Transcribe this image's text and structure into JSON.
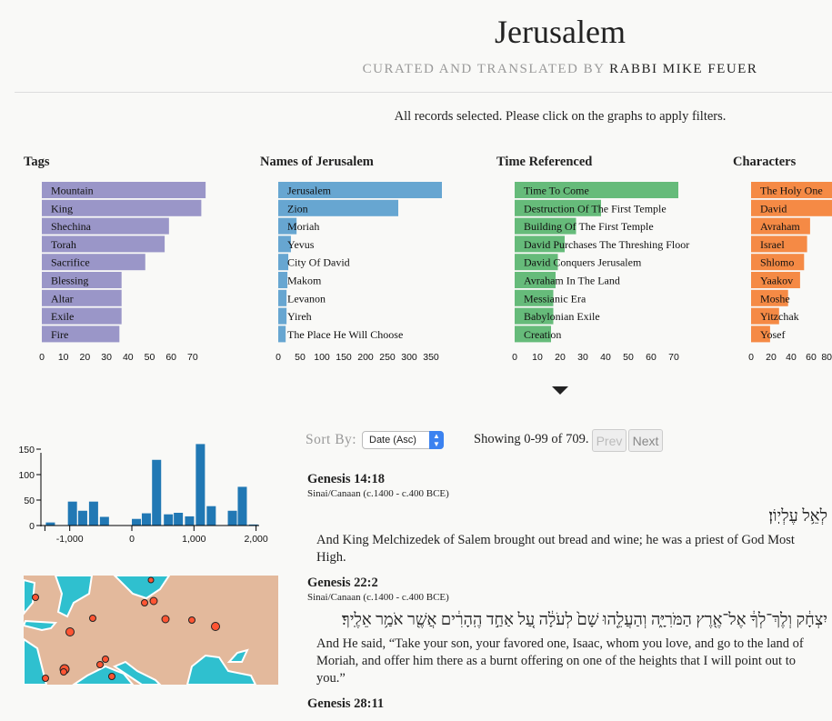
{
  "header": {
    "title": "Jerusalem",
    "subtitle_prefix": "CURATED AND TRANSLATED BY",
    "subtitle_author": "RABBI MIKE FEUER",
    "status": "All records selected. Please click on the graphs to apply filters."
  },
  "chart_data": [
    {
      "type": "bar",
      "orientation": "horizontal",
      "title": "Tags",
      "color": "#9a96c8",
      "categories": [
        "Mountain",
        "King",
        "Shechina",
        "Torah",
        "Sacrifice",
        "Blessing",
        "Altar",
        "Exile",
        "Fire"
      ],
      "values": [
        76,
        74,
        59,
        57,
        48,
        37,
        37,
        37,
        36
      ],
      "ticks": [
        0,
        10,
        20,
        30,
        40,
        50,
        60,
        70
      ],
      "xlim": [
        0,
        76
      ]
    },
    {
      "type": "bar",
      "orientation": "horizontal",
      "title": "Names of Jerusalem",
      "color": "#67a6d1",
      "categories": [
        "Jerusalem",
        "Zion",
        "Moriah",
        "Yevus",
        "City Of David",
        "Makom",
        "Levanon",
        "Yireh",
        "The Place He Will Choose"
      ],
      "values": [
        375,
        275,
        42,
        29,
        23,
        21,
        19,
        19,
        17
      ],
      "ticks": [
        0,
        50,
        100,
        150,
        200,
        250,
        300,
        350
      ],
      "xlim": [
        0,
        375
      ]
    },
    {
      "type": "bar",
      "orientation": "horizontal",
      "title": "Time Referenced",
      "color": "#66bb7a",
      "categories": [
        "Time To Come",
        "Destruction Of The First Temple",
        "Building Of The First Temple",
        "David Purchases The Threshing Floor",
        "David Conquers Jerusalem",
        "Avraham In The Land",
        "Messianic Era",
        "Babylonian Exile",
        "Creation"
      ],
      "values": [
        72,
        38,
        27,
        22,
        19,
        18,
        17,
        17,
        16
      ],
      "ticks": [
        0,
        10,
        20,
        30,
        40,
        50,
        60,
        70
      ],
      "xlim": [
        0,
        72
      ]
    },
    {
      "type": "bar",
      "orientation": "horizontal",
      "title": "Characters",
      "color": "#f58a45",
      "categories": [
        "The Holy One",
        "David",
        "Avraham",
        "Israel",
        "Shlomo",
        "Yaakov",
        "Moshe",
        "Yitzchak",
        "Yosef"
      ],
      "values": [
        100,
        95,
        59,
        56,
        53,
        49,
        37,
        28,
        19
      ],
      "ticks": [
        0,
        20,
        40,
        60,
        80
      ],
      "xlim": [
        0,
        100
      ]
    },
    {
      "type": "histogram",
      "color": "#2178b4",
      "x": [
        -1370,
        -1015,
        -850,
        -675,
        -500,
        15,
        175,
        340,
        530,
        690,
        870,
        1045,
        1220,
        1560,
        1720,
        1900
      ],
      "values": [
        6,
        47,
        29,
        47,
        17,
        13,
        24,
        129,
        22,
        25,
        18,
        160,
        38,
        29,
        76,
        2
      ],
      "xticks": [
        -1000,
        0,
        1000,
        2000
      ],
      "xtick_labels": [
        "-1,000",
        "0",
        "1,000",
        "2,000"
      ],
      "yticks": [
        0,
        50,
        100,
        150
      ],
      "xlim": [
        -1400,
        2000
      ],
      "ylim": [
        0,
        160
      ]
    }
  ],
  "map": {
    "land_color": "#e3b99c",
    "water_color": "#2fc0cf",
    "marker_color": "#ff5533"
  },
  "controls": {
    "sort_label": "Sort By:",
    "sort_value": "Date (Asc)",
    "showing": "Showing 0-99 of 709.",
    "prev": "Prev",
    "next": "Next"
  },
  "records": [
    {
      "ref": "Genesis 14:18",
      "era": "Sinai/Canaan (c.1400 - c.400 BCE)",
      "hebrew": "לְאֵ֥ל עֶלְיֽוֹן׃",
      "english": "And King Melchizedek of Salem brought out bread and wine; he was a priest of God Most High."
    },
    {
      "ref": "Genesis 22:2",
      "era": "Sinai/Canaan (c.1400 - c.400 BCE)",
      "hebrew": "יִצְחָ֔ק וְלֶךְ־לְךָ֔ אֶל־אֶ֖רֶץ הַמֹּרִיָּ֑ה וְהַעֲלֵ֤הוּ שָׁם֙ לְעֹלָ֔ה עַ֚ל אַחַ֣ד הֶֽהָרִ֔ים אֲשֶׁ֖ר אֹמַ֥ר אֵלֶֽיךָ׃",
      "english": "And He said, “Take your son, your favored one, Isaac, whom you love, and go to the land of Moriah, and offer him there as a burnt offering on one of the heights that I will point out to you.”"
    },
    {
      "ref": "Genesis 28:11"
    }
  ]
}
